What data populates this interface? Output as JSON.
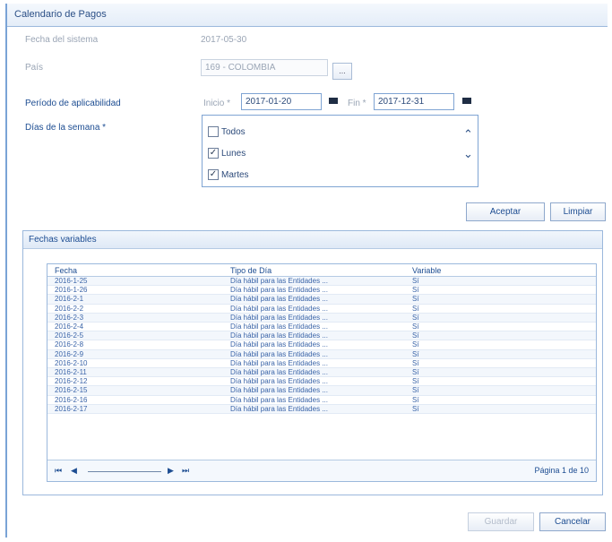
{
  "window": {
    "title": "Calendario de Pagos"
  },
  "form": {
    "fecha_sistema_label": "Fecha del sistema",
    "fecha_sistema_value": "2017-05-30",
    "pais_label": "País",
    "pais_value": "169 - COLOMBIA",
    "pais_button": "...",
    "periodo_label": "Período de aplicabilidad",
    "inicio_label": "Inicio *",
    "inicio_value": "2017-01-20",
    "fin_label": "Fin *",
    "fin_value": "2017-12-31",
    "dias_label": "Días de la semana *",
    "dias": [
      {
        "label": "Todos",
        "checked": false
      },
      {
        "label": "Lunes",
        "checked": true
      },
      {
        "label": "Martes",
        "checked": true
      }
    ]
  },
  "actions": {
    "aceptar": "Aceptar",
    "limpiar": "Limpiar",
    "guardar": "Guardar",
    "cancelar": "Cancelar"
  },
  "panel": {
    "title": "Fechas variables",
    "columns": [
      "Fecha",
      "Tipo de Día",
      "Variable"
    ],
    "rows": [
      [
        "2016-1-25",
        "Día hábil para las Entidades ...",
        "Sí"
      ],
      [
        "2016-1-26",
        "Día hábil para las Entidades ...",
        "Sí"
      ],
      [
        "2016-2-1",
        "Día hábil para las Entidades ...",
        "Sí"
      ],
      [
        "2016-2-2",
        "Día hábil para las Entidades ...",
        "Sí"
      ],
      [
        "2016-2-3",
        "Día hábil para las Entidades ...",
        "Sí"
      ],
      [
        "2016-2-4",
        "Día hábil para las Entidades ...",
        "Sí"
      ],
      [
        "2016-2-5",
        "Día hábil para las Entidades ...",
        "Sí"
      ],
      [
        "2016-2-8",
        "Día hábil para las Entidades ...",
        "Sí"
      ],
      [
        "2016-2-9",
        "Día hábil para las Entidades ...",
        "Sí"
      ],
      [
        "2016-2-10",
        "Día hábil para las Entidades ...",
        "Sí"
      ],
      [
        "2016-2-11",
        "Día hábil para las Entidades ...",
        "Sí"
      ],
      [
        "2016-2-12",
        "Día hábil para las Entidades ...",
        "Sí"
      ],
      [
        "2016-2-15",
        "Día hábil para las Entidades ...",
        "Sí"
      ],
      [
        "2016-2-16",
        "Día hábil para las Entidades ...",
        "Sí"
      ],
      [
        "2016-2-17",
        "Día hábil para las Entidades ...",
        "Sí"
      ]
    ],
    "pager_first": "⏮",
    "pager_prev": "◀",
    "pager_next": "▶",
    "pager_last": "⏭",
    "pager_text": "Página 1 de 10"
  }
}
